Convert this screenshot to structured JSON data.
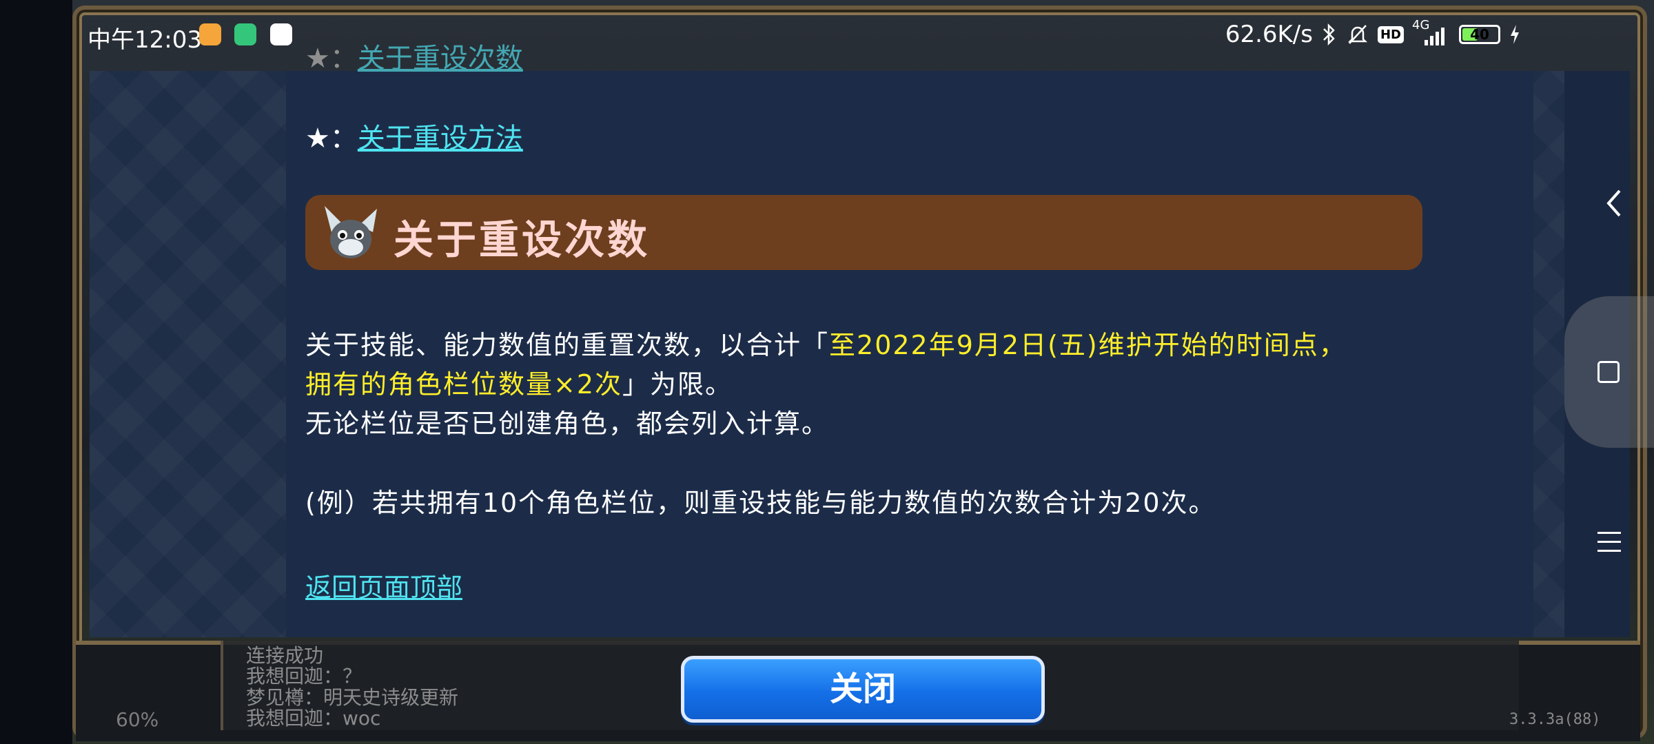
{
  "status_bar": {
    "time": "中午12:03",
    "network_speed": "62.6K/s",
    "signal_type": "4G",
    "hd_label": "HD",
    "battery_level": "40"
  },
  "links": {
    "reset_count_label": "关于重设次数",
    "reset_method_label": "关于重设方法",
    "star_prefix": "★：",
    "back_to_top": "返回页面顶部"
  },
  "section": {
    "title": "关于重设次数"
  },
  "paragraph": {
    "line1_a": "关于技能、能力数值的重置次数，以合计「",
    "line1_highlight": "至2022年9月2日(五)维护开始的时间点，",
    "line2_highlight": "拥有的角色栏位数量×2次",
    "line2_b": "」为限。",
    "line3": "无论栏位是否已创建角色，都会列入计算。",
    "example": "(例）若共拥有10个角色栏位，则重设技能与能力数值的次数合计为20次。"
  },
  "chat": {
    "lines": [
      "连接成功",
      "我想回迦：？",
      "梦见樽：明天史诗级更新",
      "我想回迦：woc"
    ]
  },
  "bottom": {
    "close_label": "关闭",
    "zoom": "60%",
    "version": "3.3.3a(88)"
  },
  "colors": {
    "link": "#4fe3f0",
    "highlight": "#ffee2a",
    "header_bg": "#6e3f1e",
    "header_text": "#ffd6d2",
    "panel_bg": "#1c2c48",
    "button": "#1570e8"
  }
}
